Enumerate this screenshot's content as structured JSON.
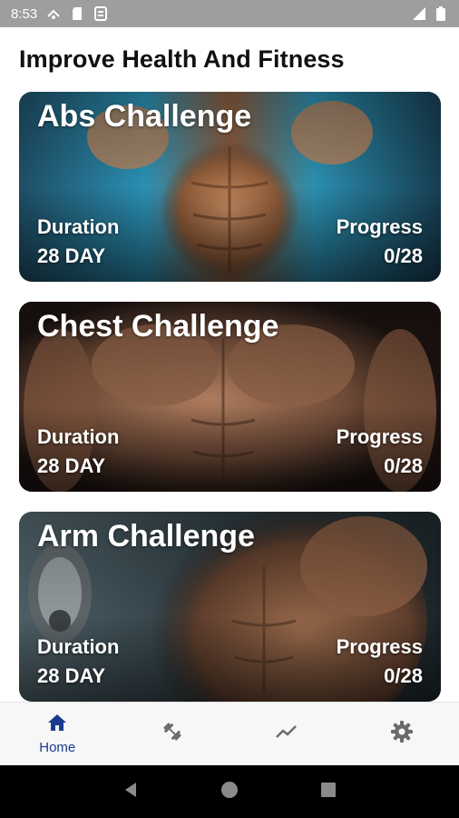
{
  "status_bar": {
    "time": "8:53"
  },
  "page": {
    "title": "Improve Health And Fitness"
  },
  "cards": [
    {
      "title": "Abs Challenge",
      "duration_label": "Duration",
      "duration_value": "28 DAY",
      "progress_label": "Progress",
      "progress_value": "0/28",
      "accent": "#2aa7c9"
    },
    {
      "title": "Chest Challenge",
      "duration_label": "Duration",
      "duration_value": "28 DAY",
      "progress_label": "Progress",
      "progress_value": "0/28",
      "accent": "#6b4a3a"
    },
    {
      "title": "Arm Challenge",
      "duration_label": "Duration",
      "duration_value": "28 DAY",
      "progress_label": "Progress",
      "progress_value": "0/28",
      "accent": "#3d4f57"
    }
  ],
  "bottom_nav": {
    "items": [
      {
        "label": "Home",
        "icon": "home-icon",
        "active": true
      },
      {
        "label": "",
        "icon": "dumbbell-icon",
        "active": false
      },
      {
        "label": "",
        "icon": "trending-icon",
        "active": false
      },
      {
        "label": "",
        "icon": "settings-icon",
        "active": false
      }
    ]
  },
  "colors": {
    "active_nav": "#1a3a8e",
    "inactive_nav": "#6b6b6b"
  }
}
